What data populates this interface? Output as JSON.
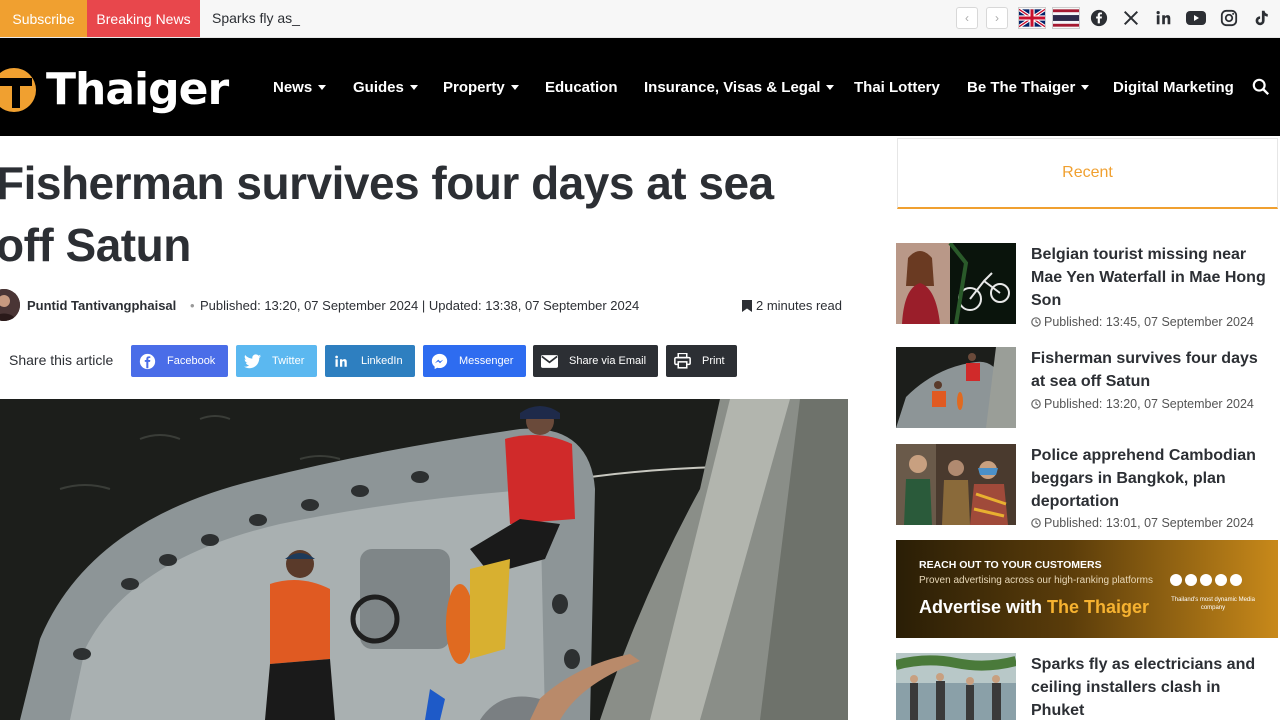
{
  "topbar": {
    "subscribe": "Subscribe",
    "breaking": "Breaking News",
    "ticker": "Sparks fly as_"
  },
  "header": {
    "logo": "Thaiger",
    "nav": [
      {
        "label": "News",
        "dropdown": true
      },
      {
        "label": "Guides",
        "dropdown": true
      },
      {
        "label": "Property",
        "dropdown": true
      },
      {
        "label": "Education",
        "dropdown": false
      },
      {
        "label": "Insurance, Visas & Legal",
        "dropdown": true
      },
      {
        "label": "Thai Lottery",
        "dropdown": false
      },
      {
        "label": "Be The Thaiger",
        "dropdown": true
      },
      {
        "label": "Digital Marketing",
        "dropdown": false
      }
    ]
  },
  "article": {
    "title_line1": "Fisherman survives four days at sea",
    "title_line2": "off Satun",
    "author": "Puntid Tantivangphaisal",
    "separator": "•",
    "dates": "Published: 13:20, 07 September 2024 | Updated: 13:38, 07 September 2024",
    "read_time": "2 minutes read",
    "share_label": "Share this article",
    "share_buttons": [
      {
        "label": "Facebook",
        "color": "#4a6de8",
        "icon": "facebook-icon"
      },
      {
        "label": "Twitter",
        "color": "#5bb8f0",
        "icon": "twitter-icon"
      },
      {
        "label": "LinkedIn",
        "color": "#2e7fc0",
        "icon": "linkedin-icon"
      },
      {
        "label": "Messenger",
        "color": "#2e6cf0",
        "icon": "messenger-icon"
      },
      {
        "label": "Share via Email",
        "color": "#2c2f34",
        "icon": "email-icon"
      },
      {
        "label": "Print",
        "color": "#2c2f34",
        "icon": "print-icon"
      }
    ]
  },
  "sidebar": {
    "tab": "Recent",
    "items": [
      {
        "title": "Belgian tourist missing near Mae Yen Waterfall in Mae Hong Son",
        "date": "Published: 13:45, 07 September 2024"
      },
      {
        "title": "Fisherman survives four days at sea off Satun",
        "date": "Published: 13:20, 07 September 2024"
      },
      {
        "title": "Police apprehend Cambodian beggars in Bangkok, plan deportation",
        "date": "Published: 13:01, 07 September 2024"
      },
      {
        "title": "Sparks fly as electricians and ceiling installers clash in Phuket",
        "date": ""
      }
    ],
    "ad": {
      "headline": "REACH OUT TO YOUR CUSTOMERS",
      "subline": "Proven advertising across our high-ranking platforms",
      "big_prefix": "Advertise with ",
      "big_brand": "The Thaiger",
      "tag": "Thailand's most dynamic Media company"
    }
  },
  "colors": {
    "accent": "#f0a030",
    "breaking": "#e8474c",
    "header_bg": "#000000"
  }
}
